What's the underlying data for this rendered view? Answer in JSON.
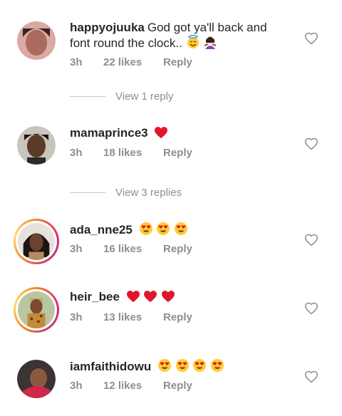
{
  "comments": [
    {
      "username": "happyojuuka",
      "text": "God got ya'll back and font round the clock..",
      "time": "3h",
      "likes": "22 likes",
      "reply": "Reply",
      "emojis": [
        "angel-face",
        "woman-gesturing"
      ]
    },
    {
      "username": "mamaprince3",
      "text": "",
      "time": "3h",
      "likes": "18 likes",
      "reply": "Reply",
      "emojis": [
        "red-heart"
      ]
    },
    {
      "username": "ada_nne25",
      "text": "",
      "time": "3h",
      "likes": "16 likes",
      "reply": "Reply",
      "emojis": [
        "heart-eyes",
        "heart-eyes",
        "heart-eyes"
      ]
    },
    {
      "username": "heir_bee",
      "text": "",
      "time": "3h",
      "likes": "13 likes",
      "reply": "Reply",
      "emojis": [
        "red-heart",
        "red-heart",
        "red-heart"
      ]
    },
    {
      "username": "iamfaithidowu",
      "text": "",
      "time": "3h",
      "likes": "12 likes",
      "reply": "Reply",
      "emojis": [
        "heart-eyes",
        "heart-eyes",
        "heart-eyes",
        "heart-eyes"
      ]
    }
  ],
  "view_replies": [
    "View 1 reply",
    "View 3 replies"
  ],
  "colors": {
    "text": "#262626",
    "meta": "#8e8e8e",
    "heart": "#e0162b",
    "ring_start": "#f58529",
    "ring_end": "#c13584"
  }
}
